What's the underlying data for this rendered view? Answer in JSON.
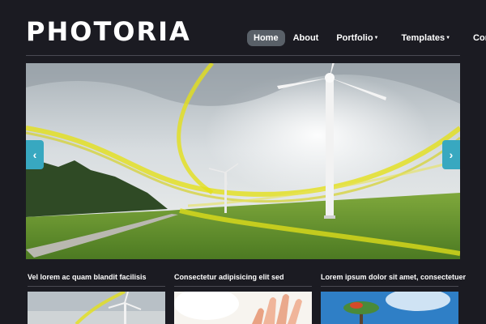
{
  "brand": {
    "name": "PHOTORIA"
  },
  "nav": {
    "items": [
      {
        "label": "Home",
        "active": true,
        "dropdown": false
      },
      {
        "label": "About",
        "active": false,
        "dropdown": false
      },
      {
        "label": "Portfolio",
        "active": false,
        "dropdown": true
      },
      {
        "label": "Templates",
        "active": false,
        "dropdown": true
      },
      {
        "label": "Contact",
        "active": false,
        "dropdown": false
      }
    ]
  },
  "slider": {
    "image": "wind-turbine-field-with-yellow-light-ribbons",
    "prev_icon": "chevron-left-icon",
    "next_icon": "chevron-right-icon",
    "prev_glyph": "‹",
    "next_glyph": "›"
  },
  "columns": [
    {
      "title": "Vel lorem ac quam blandit facilisis",
      "image": "wind-turbine-sky"
    },
    {
      "title": "Consectetur adipisicing elit sed",
      "image": "hand-bright-light"
    },
    {
      "title": "Lorem ipsum dolor sit amet, consectetuer",
      "image": "tree-blue-sky"
    }
  ],
  "colors": {
    "background": "#1b1b22",
    "accent": "#38a8c0",
    "active_nav": "#596068"
  }
}
